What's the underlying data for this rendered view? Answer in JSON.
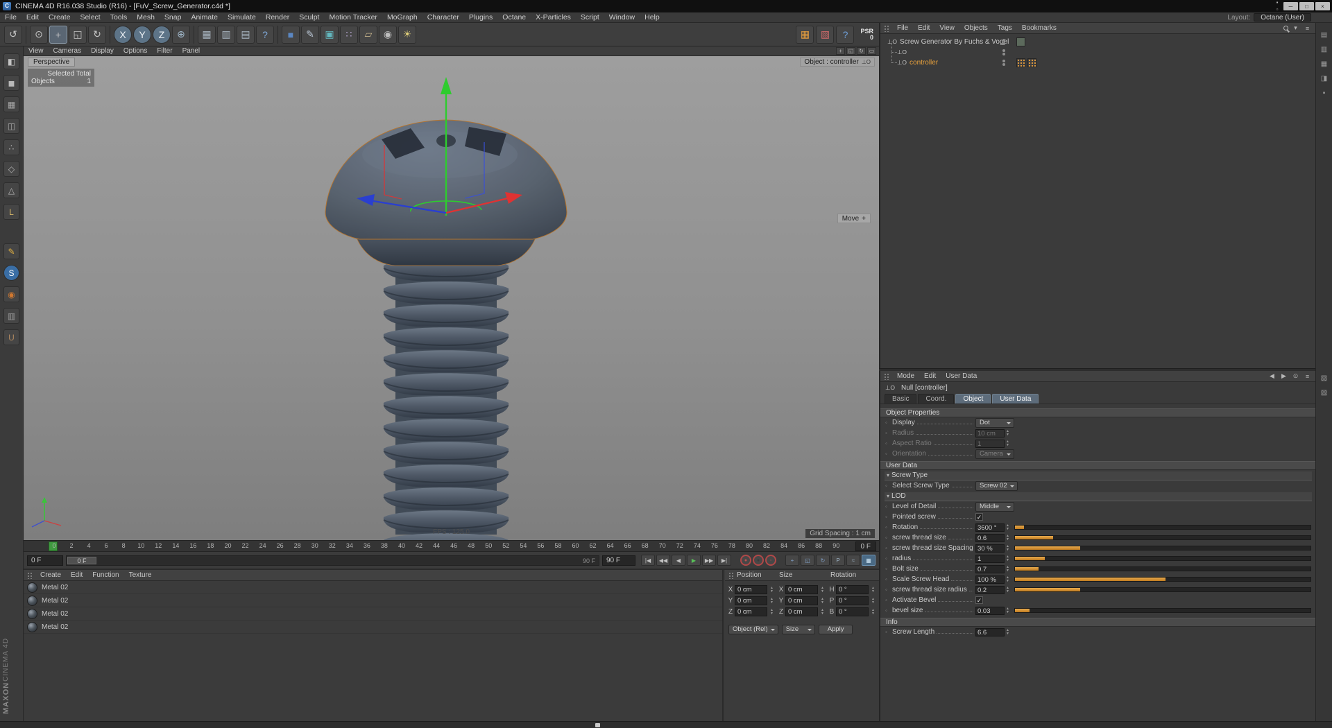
{
  "titlebar": {
    "title": "CINEMA 4D R16.038 Studio (R16) - [FuV_Screw_Generator.c4d *]",
    "app_icon_letter": "C",
    "extra_icons": [
      {
        "name": "pin-window-icon",
        "glyph": "▪"
      },
      {
        "name": "layout-window-icon",
        "glyph": "▫"
      }
    ],
    "window_buttons": [
      {
        "name": "minimize-button",
        "glyph": "─"
      },
      {
        "name": "maximize-button",
        "glyph": "□"
      },
      {
        "name": "close-button",
        "glyph": "×"
      }
    ]
  },
  "menubar": {
    "items": [
      "File",
      "Edit",
      "Create",
      "Select",
      "Tools",
      "Mesh",
      "Snap",
      "Animate",
      "Simulate",
      "Render",
      "Sculpt",
      "Motion Tracker",
      "MoGraph",
      "Character",
      "Plugins",
      "Octane",
      "X-Particles",
      "Script",
      "Window",
      "Help"
    ],
    "layout_label": "Layout:",
    "layout_value": "Octane (User)"
  },
  "toolbar": {
    "icons": [
      {
        "name": "undo-icon",
        "glyph": "↺"
      },
      {
        "sep": true
      },
      {
        "name": "live-selection-icon",
        "glyph": "⊙"
      },
      {
        "name": "move-tool-icon",
        "glyph": "+",
        "active": true
      },
      {
        "name": "scale-tool-icon",
        "glyph": "◱"
      },
      {
        "name": "rotate-tool-icon",
        "glyph": "↻"
      },
      {
        "sep": true
      },
      {
        "name": "lock-x-axis-icon",
        "glyph": "X",
        "bg": "#5d7488",
        "fg": "#eef2f6",
        "round": true
      },
      {
        "name": "lock-y-axis-icon",
        "glyph": "Y",
        "bg": "#5d7488",
        "fg": "#eef2f6",
        "round": true
      },
      {
        "name": "lock-z-axis-icon",
        "glyph": "Z",
        "bg": "#5d7488",
        "fg": "#eef2f6",
        "round": true
      },
      {
        "name": "coordinate-system-icon",
        "glyph": "⊕",
        "fg": "#9fb6c8"
      },
      {
        "sep": true
      },
      {
        "name": "render-view-icon",
        "glyph": "▦",
        "fg": "#a8b4c0"
      },
      {
        "name": "render-picture-viewer-icon",
        "glyph": "▥",
        "fg": "#a8b4c0"
      },
      {
        "name": "render-settings-icon",
        "glyph": "▤",
        "fg": "#a8b4c0"
      },
      {
        "name": "interactive-render-region-icon",
        "glyph": "?",
        "fg": "#7fa8d8"
      },
      {
        "sep": true
      },
      {
        "name": "add-primitive-cube-icon",
        "glyph": "■",
        "fg": "#5b87c2"
      },
      {
        "name": "spline-pen-icon",
        "glyph": "✎",
        "fg": "#b9c6d4"
      },
      {
        "name": "subdivision-surface-icon",
        "glyph": "▣",
        "fg": "#63b8bf"
      },
      {
        "name": "mograph-array-icon",
        "glyph": "∷",
        "fg": "#b9a9d4"
      },
      {
        "name": "floor-object-icon",
        "glyph": "▱",
        "fg": "#c2b089"
      },
      {
        "name": "camera-object-icon",
        "glyph": "◉",
        "fg": "#bdbdbd"
      },
      {
        "name": "light-object-icon",
        "glyph": "☀",
        "fg": "#e0cf7a"
      }
    ],
    "right_icons": [
      {
        "name": "octane-render-icon",
        "glyph": "▦",
        "fg": "#e09a3e"
      },
      {
        "name": "render-queue-icon",
        "glyph": "▧",
        "fg": "#d06a6a"
      },
      {
        "name": "help-icon",
        "glyph": "?",
        "fg": "#6f9fd8"
      }
    ],
    "psr_label": "PSR",
    "psr_value": "0"
  },
  "left_toolbar": {
    "icons": [
      {
        "name": "make-editable-icon",
        "glyph": "◧",
        "fg": "#c4c4c4"
      },
      {
        "name": "model-mode-icon",
        "glyph": "◼",
        "fg": "#b8b8b8"
      },
      {
        "name": "texture-mode-icon",
        "glyph": "▦",
        "fg": "#a8a8a8"
      },
      {
        "name": "workplane-mode-icon",
        "glyph": "◫",
        "fg": "#a8a8a8"
      },
      {
        "name": "points-mode-icon",
        "glyph": "∴",
        "fg": "#b8b8b8"
      },
      {
        "name": "edges-mode-icon",
        "glyph": "◇",
        "fg": "#b8b8b8"
      },
      {
        "name": "polygons-mode-icon",
        "glyph": "△",
        "fg": "#b8b8b8"
      },
      {
        "name": "axis-mode-icon",
        "glyph": "L",
        "fg": "#d8b868"
      },
      {
        "gap": true
      },
      {
        "name": "pen-tool-icon",
        "glyph": "✎",
        "fg": "#e0b040"
      },
      {
        "name": "snap-icon",
        "glyph": "S",
        "bg": "#3a6ea5",
        "fg": "#ffffff",
        "round": true
      },
      {
        "name": "paint-icon",
        "glyph": "◉",
        "fg": "#d07830"
      },
      {
        "name": "lock-workplane-icon",
        "glyph": "▥",
        "fg": "#9a9a9a"
      },
      {
        "name": "magnet-icon",
        "glyph": "U",
        "fg": "#b08860"
      }
    ]
  },
  "brand": {
    "line1": "MAXON",
    "line2": "CINEMA 4D"
  },
  "viewport": {
    "menu": [
      "View",
      "Cameras",
      "Display",
      "Options",
      "Filter",
      "Panel"
    ],
    "cam_icons": [
      {
        "name": "camera-pan-icon",
        "glyph": "+"
      },
      {
        "name": "camera-zoom-icon",
        "glyph": "◱"
      },
      {
        "name": "camera-rotate-icon",
        "glyph": "↻"
      },
      {
        "name": "view-toggle-icon",
        "glyph": "▭"
      }
    ],
    "label": "Perspective",
    "object_chip": "Object : controller",
    "move_chip": "Move",
    "selected_overlay": {
      "line1": "Selected Total",
      "line2_label": "Objects",
      "line2_value": "1"
    },
    "fps": "FPS : 125.0",
    "grid_spacing": "Grid Spacing : 1 cm"
  },
  "timeline": {
    "ticks": [
      0,
      2,
      4,
      6,
      8,
      10,
      12,
      14,
      16,
      18,
      20,
      22,
      24,
      26,
      28,
      30,
      32,
      34,
      36,
      38,
      40,
      42,
      44,
      46,
      48,
      50,
      52,
      54,
      56,
      58,
      60,
      62,
      64,
      66,
      68,
      70,
      72,
      74,
      76,
      78,
      80,
      82,
      84,
      86,
      88,
      90
    ],
    "ruler_frame_field": "0 F",
    "current_frame_field": "0 F",
    "range_handle": "0 F",
    "range_end_label": "90 F",
    "end_frame_field": "90 F",
    "transport": [
      {
        "name": "goto-start-button",
        "glyph": "|◀"
      },
      {
        "name": "prev-key-button",
        "glyph": "◀◀"
      },
      {
        "name": "prev-frame-button",
        "glyph": "◀"
      },
      {
        "name": "play-button",
        "glyph": "▶",
        "fg": "#58c058"
      },
      {
        "name": "next-frame-button",
        "glyph": "▶▶"
      },
      {
        "name": "goto-end-button",
        "glyph": "▶|"
      },
      {
        "gap": true
      },
      {
        "name": "record-keyframe-button",
        "glyph": "●",
        "ring": true,
        "fg": "#c05050"
      },
      {
        "name": "autokeying-button",
        "glyph": "●",
        "ring": true,
        "fg": "#3a3a3a"
      },
      {
        "name": "keyframe-selection-button",
        "glyph": "◦",
        "ring": true,
        "fg": "#c05050"
      },
      {
        "gap": true
      },
      {
        "name": "record-position-button",
        "glyph": "+",
        "fg": "#7f9fc6"
      },
      {
        "name": "record-scale-button",
        "glyph": "◱",
        "fg": "#7f9fc6"
      },
      {
        "name": "record-rotation-button",
        "glyph": "↻",
        "fg": "#7f9fc6"
      },
      {
        "name": "record-parameter-button",
        "glyph": "P",
        "fg": "#9fb6c8"
      },
      {
        "name": "record-pla-button",
        "glyph": "≈",
        "fg": "#9fb6c8"
      },
      {
        "name": "timeline-mode-button",
        "glyph": "▦",
        "fg": "#cfe6f5",
        "active": true
      }
    ]
  },
  "materials": {
    "menu": [
      "Create",
      "Edit",
      "Function",
      "Texture"
    ],
    "items": [
      "Metal 02",
      "Metal 02",
      "Metal 02",
      "Metal 02"
    ]
  },
  "coords": {
    "columns": [
      {
        "header": "Position",
        "cells": [
          [
            "X",
            "0 cm"
          ],
          [
            "Y",
            "0 cm"
          ],
          [
            "Z",
            "0 cm"
          ]
        ]
      },
      {
        "header": "Size",
        "cells": [
          [
            "X",
            "0 cm"
          ],
          [
            "Y",
            "0 cm"
          ],
          [
            "Z",
            "0 cm"
          ]
        ]
      },
      {
        "header": "Rotation",
        "cells": [
          [
            "H",
            "0 °"
          ],
          [
            "P",
            "0 °"
          ],
          [
            "B",
            "0 °"
          ]
        ]
      }
    ],
    "mode_dropdown": "Object (Rel)",
    "axis_dropdown": "Size",
    "apply_label": "Apply"
  },
  "object_manager": {
    "menu": [
      "File",
      "Edit",
      "View",
      "Objects",
      "Tags",
      "Bookmarks"
    ],
    "null_icon": "⊥O",
    "right_icons": [
      {
        "name": "search-icon",
        "css": "mag"
      },
      {
        "name": "filter-icon",
        "glyph": "▾"
      },
      {
        "name": "panel-menu-icon",
        "glyph": "≡"
      }
    ],
    "rows": [
      {
        "label": "Screw Generator By Fuchs & Vogel",
        "indent": 0,
        "selected": false,
        "tags": [
          "display-tag"
        ]
      },
      {
        "label": "",
        "indent": 1,
        "selected": false,
        "tags": []
      },
      {
        "label": "controller",
        "indent": 1,
        "selected": true,
        "tags": [
          "selection-tag",
          "selection-tag"
        ]
      }
    ]
  },
  "attributes": {
    "menu": [
      "Mode",
      "Edit",
      "User Data"
    ],
    "object_icon": "⊥O",
    "object_title": "Null [controller]",
    "right_icons": [
      {
        "name": "history-back-icon",
        "glyph": "◀"
      },
      {
        "name": "history-forward-icon",
        "glyph": "▶"
      },
      {
        "name": "pin-panel-icon",
        "glyph": "⊙"
      },
      {
        "name": "panel-menu-icon",
        "glyph": "≡"
      }
    ],
    "tabs": [
      {
        "label": "Basic"
      },
      {
        "label": "Coord."
      },
      {
        "label": "Object",
        "active": true
      },
      {
        "label": "User Data",
        "active": true
      }
    ],
    "blocks": [
      {
        "type": "section",
        "title": "Object Properties"
      },
      {
        "type": "row",
        "control": "dropdown",
        "label": "Display",
        "value": "Dot"
      },
      {
        "type": "row",
        "control": "number",
        "label": "Radius",
        "value": "10 cm",
        "disabled": true
      },
      {
        "type": "row",
        "control": "number",
        "label": "Aspect Ratio",
        "value": "1",
        "disabled": true
      },
      {
        "type": "row",
        "control": "dropdown",
        "label": "Orientation",
        "value": "Camera",
        "disabled": true
      },
      {
        "type": "section",
        "title": "User Data"
      },
      {
        "type": "group",
        "title": "Screw Type"
      },
      {
        "type": "row",
        "control": "dropdown",
        "label": "Select Screw Type",
        "value": "Screw 02"
      },
      {
        "type": "group",
        "title": "LOD"
      },
      {
        "type": "row",
        "control": "dropdown",
        "label": "Level of Detail",
        "value": "Middle"
      },
      {
        "type": "row",
        "control": "checkbox",
        "label": "Pointed screw",
        "checked": true
      },
      {
        "type": "row",
        "control": "slider",
        "label": "Rotation",
        "value": "3600 °",
        "fill": 3
      },
      {
        "type": "row",
        "control": "slider",
        "label": "screw thread size",
        "value": "0.6",
        "fill": 13
      },
      {
        "type": "row",
        "control": "slider",
        "label": "screw thread size Spacing",
        "value": "30 %",
        "fill": 22
      },
      {
        "type": "row",
        "control": "slider",
        "label": "radius",
        "value": "1",
        "fill": 10
      },
      {
        "type": "row",
        "control": "slider",
        "label": "Bolt size",
        "value": "0.7",
        "fill": 8
      },
      {
        "type": "row",
        "control": "slider",
        "label": "Scale Screw Head",
        "value": "100 %",
        "fill": 51
      },
      {
        "type": "row",
        "control": "slider",
        "label": "screw thread size radius",
        "value": "0.2",
        "fill": 22
      },
      {
        "type": "row",
        "control": "checkbox",
        "label": "Activate Bevel",
        "checked": true
      },
      {
        "type": "row",
        "control": "slider",
        "label": "bevel size",
        "value": "0.03",
        "fill": 5
      },
      {
        "type": "section",
        "title": "Info"
      },
      {
        "type": "row",
        "control": "number",
        "label": "Screw Length",
        "value": "6.6"
      }
    ]
  },
  "side_strip": {
    "top": [
      {
        "name": "objects-panel-icon",
        "glyph": "▤"
      },
      {
        "name": "structure-panel-icon",
        "glyph": "▥"
      },
      {
        "name": "content-browser-icon",
        "glyph": "▦"
      },
      {
        "name": "layers-panel-icon",
        "glyph": "◨"
      },
      {
        "name": "lock-panel-icon",
        "glyph": "▪"
      }
    ],
    "mid": [
      {
        "name": "attributes-panel-icon",
        "glyph": "▧"
      },
      {
        "name": "layer-panel-icon",
        "glyph": "▨"
      }
    ]
  },
  "statusbar": {
    "icons": [
      {
        "name": "script-log-icon",
        "glyph": ""
      }
    ]
  }
}
